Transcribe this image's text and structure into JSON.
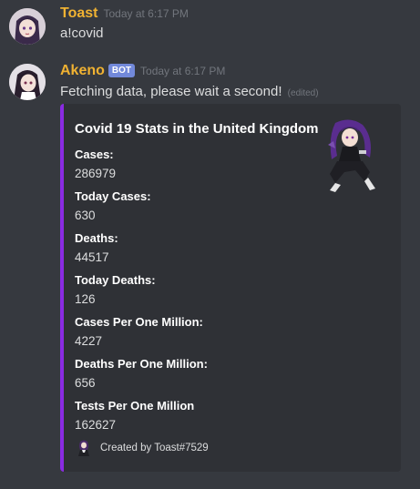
{
  "messages": [
    {
      "author": "Toast",
      "author_color": "#f0b232",
      "timestamp": "Today at 6:17 PM",
      "content": "a!covid"
    },
    {
      "author": "Akeno",
      "author_color": "#f0b232",
      "bot_tag": "BOT",
      "timestamp": "Today at 6:17 PM",
      "content": "Fetching data, please wait a second!",
      "edited": "(edited)"
    }
  ],
  "embed": {
    "accent_color": "#8a2be2",
    "title": "Covid 19 Stats in the United Kingdom",
    "fields": [
      {
        "name": "Cases:",
        "value": "286979"
      },
      {
        "name": "Today Cases:",
        "value": "630"
      },
      {
        "name": "Deaths:",
        "value": "44517"
      },
      {
        "name": "Today Deaths:",
        "value": "126"
      },
      {
        "name": "Cases Per One Million:",
        "value": "4227"
      },
      {
        "name": "Deaths Per One Million:",
        "value": "656"
      },
      {
        "name": "Tests Per One Million",
        "value": "162627"
      }
    ],
    "footer": "Created by Toast#7529"
  }
}
